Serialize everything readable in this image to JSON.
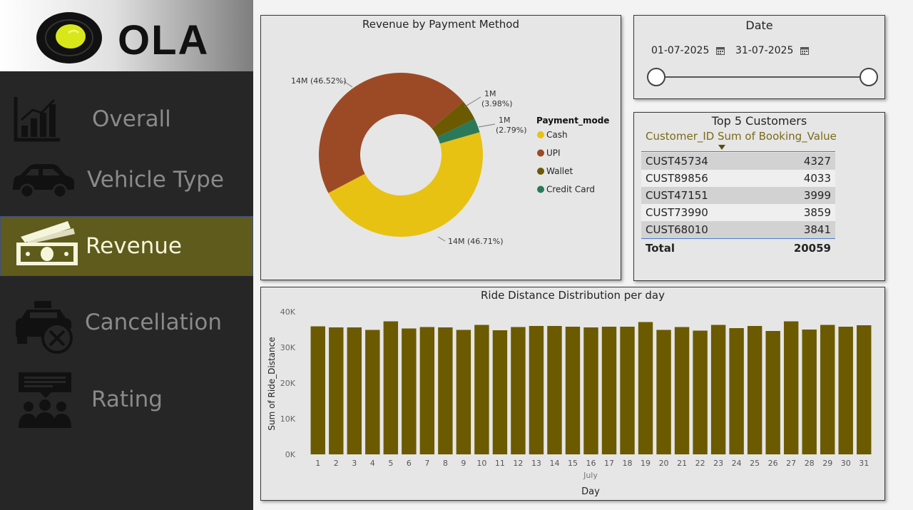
{
  "brand": {
    "name": "OLA"
  },
  "nav": {
    "items": [
      {
        "label": "Overall"
      },
      {
        "label": "Vehicle Type"
      },
      {
        "label": "Revenue"
      },
      {
        "label": "Cancellation"
      },
      {
        "label": "Rating"
      }
    ],
    "active": "Revenue"
  },
  "colors": {
    "accent": "#6b5a00",
    "active_nav": "#5f5b1c",
    "sidebar": "#262626",
    "cash": "#e8c213",
    "upi": "#9c4a26",
    "wallet": "#6b5a00",
    "credit_card": "#2a7a5a"
  },
  "date_filter": {
    "title": "Date",
    "start": "01-07-2025",
    "end": "31-07-2025",
    "start_icon": "calendar-icon",
    "end_icon": "calendar-icon"
  },
  "top_customers": {
    "title": "Top 5 Customers",
    "columns": [
      "Customer_ID",
      "Sum of Booking_Value"
    ],
    "rows": [
      {
        "id": "CUST45734",
        "value": "4327"
      },
      {
        "id": "CUST89856",
        "value": "4033"
      },
      {
        "id": "CUST47151",
        "value": "3999"
      },
      {
        "id": "CUST73990",
        "value": "3859"
      },
      {
        "id": "CUST68010",
        "value": "3841"
      }
    ],
    "total_label": "Total",
    "total_value": "20059"
  },
  "chart_data": [
    {
      "type": "pie",
      "title": "Revenue by Payment Method",
      "legend_title": "Payment_mode",
      "legend_position": "right",
      "donut": true,
      "slices": [
        {
          "label": "Cash",
          "value": 46.71,
          "data_label": "14M (46.71%)",
          "color": "#e8c213"
        },
        {
          "label": "UPI",
          "value": 46.52,
          "data_label": "14M (46.52%)",
          "color": "#9c4a26"
        },
        {
          "label": "Wallet",
          "value": 3.98,
          "data_label": "1M (3.98%)",
          "color": "#6b5a00"
        },
        {
          "label": "Credit Card",
          "value": 2.79,
          "data_label": "1M (2.79%)",
          "color": "#2a7a5a"
        }
      ]
    },
    {
      "type": "bar",
      "title": "Ride Distance Distribution per day",
      "xlabel": "Day",
      "x_group_label": "July",
      "ylabel": "Sum of Ride_Distance",
      "ylim": [
        0,
        40000
      ],
      "yticks": [
        0,
        10000,
        20000,
        30000,
        40000
      ],
      "ytick_labels": [
        "0K",
        "10K",
        "20K",
        "30K",
        "40K"
      ],
      "grid": false,
      "bar_color": "#6b5a00",
      "categories": [
        "1",
        "2",
        "3",
        "4",
        "5",
        "6",
        "7",
        "8",
        "9",
        "10",
        "11",
        "12",
        "13",
        "14",
        "15",
        "16",
        "17",
        "18",
        "19",
        "20",
        "21",
        "22",
        "23",
        "24",
        "25",
        "26",
        "27",
        "28",
        "29",
        "30",
        "31"
      ],
      "values": [
        35900,
        35600,
        35600,
        34900,
        37300,
        35300,
        35700,
        35600,
        34900,
        36300,
        34800,
        35700,
        36000,
        36000,
        35800,
        35600,
        35800,
        35800,
        37100,
        34900,
        35700,
        34700,
        36300,
        35400,
        36000,
        34600,
        37300,
        35000,
        36300,
        35800,
        36200
      ]
    }
  ]
}
